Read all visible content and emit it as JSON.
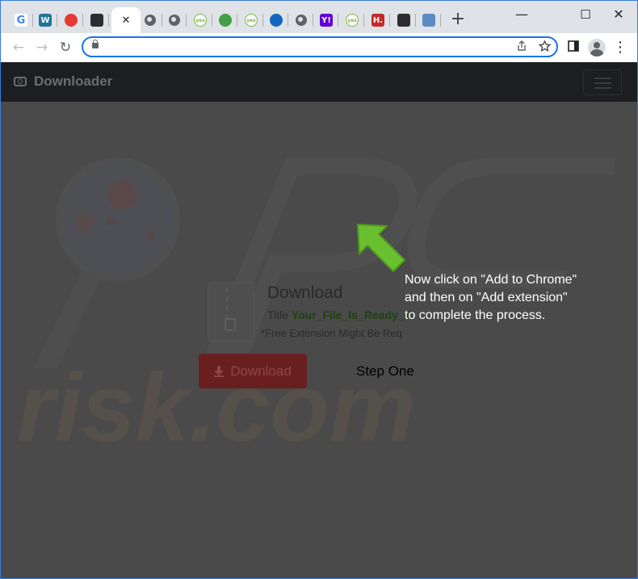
{
  "browser": {
    "tabs": [
      {
        "icon": "google-icon",
        "letter": "G",
        "color": "#4285f4"
      },
      {
        "icon": "wordpress-icon",
        "letter": "W",
        "color": "#21759b"
      },
      {
        "icon": "red-circle-icon",
        "letter": "",
        "color": "#e53935"
      },
      {
        "icon": "terminal-icon",
        "letter": "",
        "color": "#2d2d2d"
      },
      {
        "icon": "close-icon",
        "active": true
      },
      {
        "icon": "globe-icon"
      },
      {
        "icon": "globe-icon"
      },
      {
        "icon": "yes-icon",
        "letter": "yes",
        "color": "#7cb342"
      },
      {
        "icon": "alien-icon",
        "letter": "",
        "color": "#43a047"
      },
      {
        "icon": "yes-icon",
        "letter": "yes",
        "color": "#7cb342"
      },
      {
        "icon": "blue-dots-icon",
        "letter": "",
        "color": "#1565c0"
      },
      {
        "icon": "globe-icon"
      },
      {
        "icon": "yahoo-icon",
        "letter": "Y!",
        "color": "#6001d2"
      },
      {
        "icon": "yes-icon",
        "letter": "yes",
        "color": "#7cb342"
      },
      {
        "icon": "h-icon",
        "letter": "H.",
        "color": "#c62828"
      },
      {
        "icon": "terminal-icon",
        "letter": "",
        "color": "#2d2d2d"
      },
      {
        "icon": "crossed-icon",
        "letter": "",
        "color": "#5c8bc4"
      }
    ],
    "new_tab_label": "+",
    "window_controls": {
      "minimize": "—",
      "maximize": "☐",
      "close": "✕"
    },
    "address": {
      "url": ""
    },
    "nav": {
      "back": "←",
      "forward": "→",
      "reload": "↻"
    },
    "menu_glyph": "⋮"
  },
  "site": {
    "brand": "Downloader",
    "download": {
      "heading": "Download",
      "title_label": "Title",
      "file_name": "Your_File_Is_Ready_T",
      "note": "*Free Extension Might Be Req",
      "button_label": "Download"
    },
    "step_label": "Step One",
    "instruction": "Now click on \"Add to Chrome\" and then on \"Add extension\" to complete the process.",
    "arrow_color": "#6abf2e"
  }
}
